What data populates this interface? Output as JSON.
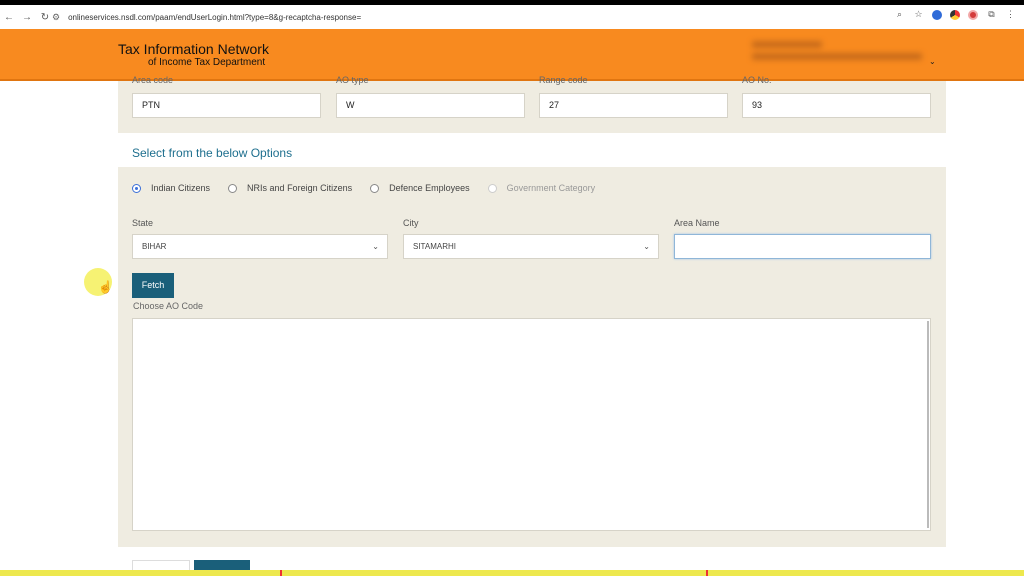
{
  "browser": {
    "url": "onlineservices.nsdl.com/paam/endUserLogin.html?type=8&g-recaptcha-response=",
    "back_icon": "back-arrow-icon",
    "forward_icon": "forward-arrow-icon",
    "reload_icon": "reload-icon"
  },
  "header": {
    "brand_line1": "Tax Information Network",
    "brand_line2": "of Income Tax Department",
    "bg_color": "#f88a1f"
  },
  "ao_fields": [
    {
      "label": "Area code",
      "value": "PTN"
    },
    {
      "label": "AO type",
      "value": "W"
    },
    {
      "label": "Range code",
      "value": "27"
    },
    {
      "label": "AO No.",
      "value": "93"
    }
  ],
  "options": {
    "title": "Select from the below Options",
    "radios": [
      {
        "label": "Indian Citizens",
        "selected": true
      },
      {
        "label": "NRIs and Foreign Citizens",
        "selected": false
      },
      {
        "label": "Defence Employees",
        "selected": false
      },
      {
        "label": "Government Category",
        "selected": false
      }
    ]
  },
  "filters": {
    "state_label": "State",
    "state_value": "BIHAR",
    "city_label": "City",
    "city_value": "SITAMARHI",
    "area_label": "Area Name",
    "area_value": ""
  },
  "fetch": {
    "label": "Fetch"
  },
  "ao_code": {
    "label": "Choose AO Code"
  },
  "colors": {
    "accent": "#1a5f7a",
    "title": "#1e6f8e",
    "panel": "#efece1"
  }
}
